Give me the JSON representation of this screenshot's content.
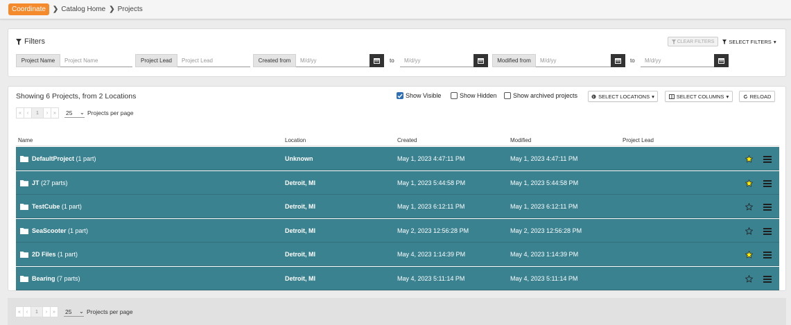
{
  "app": {
    "brand": "Coordinate"
  },
  "breadcrumb": [
    "Catalog Home",
    "Projects"
  ],
  "filters": {
    "title": "Filters",
    "clear_label": "CLEAR FILTERS",
    "select_label": "SELECT FILTERS",
    "project_name_label": "Project Name",
    "project_name_placeholder": "Project Name",
    "project_lead_label": "Project Lead",
    "project_lead_placeholder": "Project Lead",
    "created_from_label": "Created from",
    "modified_from_label": "Modified from",
    "date_placeholder": "M/d/yy",
    "to_label": "to"
  },
  "list": {
    "showing_text": "Showing 6 Projects, from 2 Locations",
    "show_visible": "Show Visible",
    "show_hidden": "Show Hidden",
    "show_archived": "Show archived projects",
    "select_locations": "SELECT LOCATIONS",
    "select_columns": "SELECT COLUMNS",
    "reload": "RELOAD",
    "pager": {
      "first": "«",
      "prev": "‹",
      "page": "1",
      "next": "›",
      "last": "»",
      "per_page_value": "25",
      "per_page_label": "Projects per page"
    },
    "columns": [
      "Name",
      "Location",
      "Created",
      "Modified",
      "Project Lead"
    ],
    "rows": [
      {
        "name": "DefaultProject",
        "parts": "(1 part)",
        "location": "Unknown",
        "created": "May 1, 2023 4:47:11 PM",
        "modified": "May 1, 2023 4:47:11 PM",
        "lead": "",
        "starred": true
      },
      {
        "name": "JT",
        "parts": "(27 parts)",
        "location": "Detroit, MI",
        "created": "May 1, 2023 5:44:58 PM",
        "modified": "May 1, 2023 5:44:58 PM",
        "lead": "",
        "starred": true
      },
      {
        "name": "TestCube",
        "parts": "(1 part)",
        "location": "Detroit, MI",
        "created": "May 1, 2023 6:12:11 PM",
        "modified": "May 1, 2023 6:12:11 PM",
        "lead": "",
        "starred": false
      },
      {
        "name": "SeaScooter",
        "parts": "(1 part)",
        "location": "Detroit, MI",
        "created": "May 2, 2023 12:56:28 PM",
        "modified": "May 2, 2023 12:56:28 PM",
        "lead": "",
        "starred": false
      },
      {
        "name": "2D Files",
        "parts": "(1 part)",
        "location": "Detroit, MI",
        "created": "May 4, 2023 1:14:39 PM",
        "modified": "May 4, 2023 1:14:39 PM",
        "lead": "",
        "starred": true
      },
      {
        "name": "Bearing",
        "parts": "(7 parts)",
        "location": "Detroit, MI",
        "created": "May 4, 2023 5:11:14 PM",
        "modified": "May 4, 2023 5:11:14 PM",
        "lead": "",
        "starred": false
      }
    ]
  },
  "colors": {
    "brand": "#f58a2c",
    "row": "#3a8290",
    "star_on": "#ffee00",
    "checkbox_on": "#2f6fb5"
  }
}
